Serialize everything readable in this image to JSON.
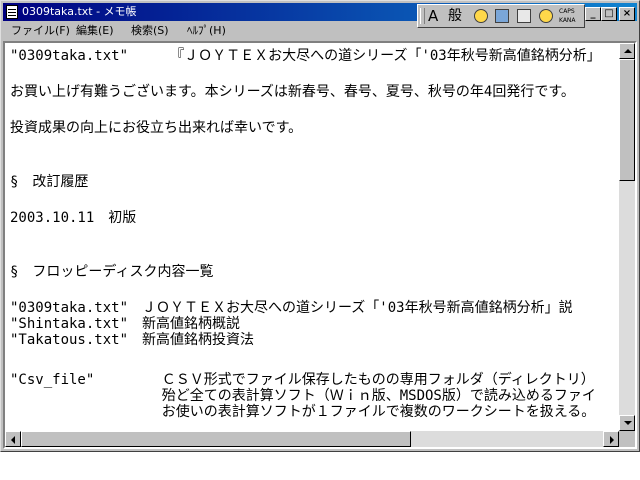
{
  "window": {
    "title": "0309taka.txt - メモ帳",
    "min_label": "_",
    "max_label": "□",
    "close_label": "×"
  },
  "ime": {
    "mode": "A",
    "kanji": "般",
    "caps_label": "CAPS",
    "kana_label": "KANA"
  },
  "menu": [
    "ファイル(F)",
    "編集(E)",
    "検索(S)",
    "ﾍﾙﾌﾟ(H)"
  ],
  "lines": [
    "\"0309taka.txt\"     『ＪＯＹＴＥＸお大尽への道シリーズ「'03年秋号新高値銘柄分析」",
    "",
    "お買い上げ有難うございます。本シリーズは新春号、春号、夏号、秋号の年4回発行です。",
    "",
    "投資成果の向上にお役立ち出来れば幸いです。",
    "",
    "",
    "",
    "§　改訂履歴",
    "",
    "2003.10.11　初版",
    "",
    "",
    "",
    "§　フロッピーディスク内容一覧",
    "",
    "\"0309taka.txt\"　ＪＯＹＴＥＸお大尽への道シリーズ「'03年秋号新高値銘柄分析」説",
    "\"Shintaka.txt\"　新高値銘柄概説",
    "\"Takatous.txt\"　新高値銘柄投資法",
    "",
    "\"Csv_file\"        ＣＳＶ形式でファイル保存したものの専用フォルダ（ディレクトリ）",
    "                  殆ど全ての表計算ソフト（Ｗｉｎ版、MSDOS版）で読み込めるファイ",
    "                  お使いの表計算ソフトが１ファイルで複数のワークシートを扱える。"
  ]
}
